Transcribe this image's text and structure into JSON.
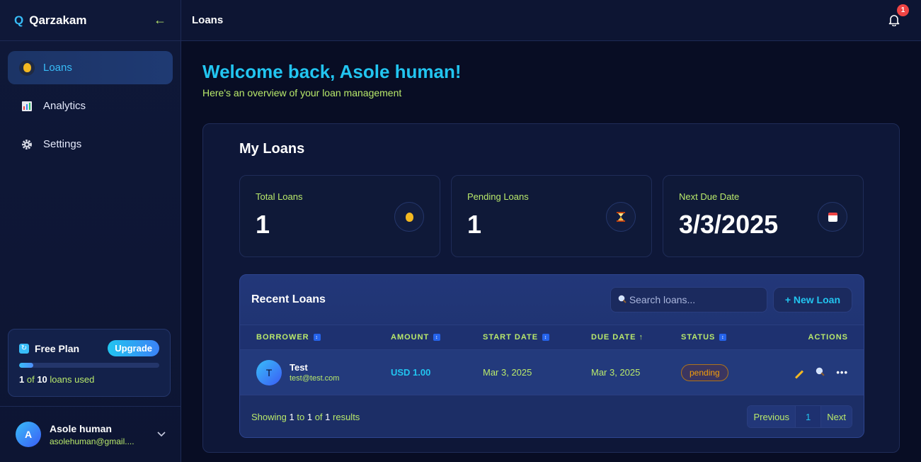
{
  "brand": {
    "logo_letter": "Q",
    "name": "Qarzakam",
    "collapse_glyph": "←"
  },
  "sidebar": {
    "items": [
      {
        "label": "Loans",
        "icon": "money-bag-icon",
        "active": true
      },
      {
        "label": "Analytics",
        "icon": "bar-chart-icon",
        "active": false
      },
      {
        "label": "Settings",
        "icon": "gear-icon",
        "active": false
      }
    ]
  },
  "plan": {
    "name": "Free Plan",
    "upgrade_label": "Upgrade",
    "used": "1",
    "of_text": "of",
    "limit": "10",
    "usage_suffix": "loans used",
    "progress_fraction": 0.1
  },
  "user": {
    "initial": "A",
    "name": "Asole human",
    "email": "asolehuman@gmail...."
  },
  "topbar": {
    "title": "Loans",
    "notification_count": "1"
  },
  "welcome": {
    "heading": "Welcome back, Asole human!",
    "subheading": "Here's an overview of your loan management"
  },
  "panel": {
    "title": "My Loans"
  },
  "stats": [
    {
      "label": "Total Loans",
      "value": "1",
      "icon": "money-bag-icon"
    },
    {
      "label": "Pending Loans",
      "value": "1",
      "icon": "hourglass-icon"
    },
    {
      "label": "Next Due Date",
      "value": "3/3/2025",
      "icon": "calendar-icon"
    }
  ],
  "recent": {
    "title": "Recent Loans",
    "search_placeholder": "Search loans...",
    "new_loan_label": "+ New Loan",
    "columns": [
      "BORROWER",
      "AMOUNT",
      "START DATE",
      "DUE DATE ↑",
      "STATUS",
      "ACTIONS"
    ],
    "rows": [
      {
        "initial": "T",
        "name": "Test",
        "email": "test@test.com",
        "amount": "USD 1.00",
        "start_date": "Mar 3, 2025",
        "due_date": "Mar 3, 2025",
        "status": "pending"
      }
    ],
    "footer": {
      "showing": "Showing",
      "from": "1",
      "to_text": "to",
      "to": "1",
      "of_text": "of",
      "total": "1",
      "results": "results"
    },
    "pager": {
      "previous": "Previous",
      "current": "1",
      "next": "Next"
    }
  },
  "colors": {
    "accent": "#22c5f0",
    "lime": "#b9e96b",
    "pending": "#f59e0b",
    "badge": "#ef4444"
  }
}
